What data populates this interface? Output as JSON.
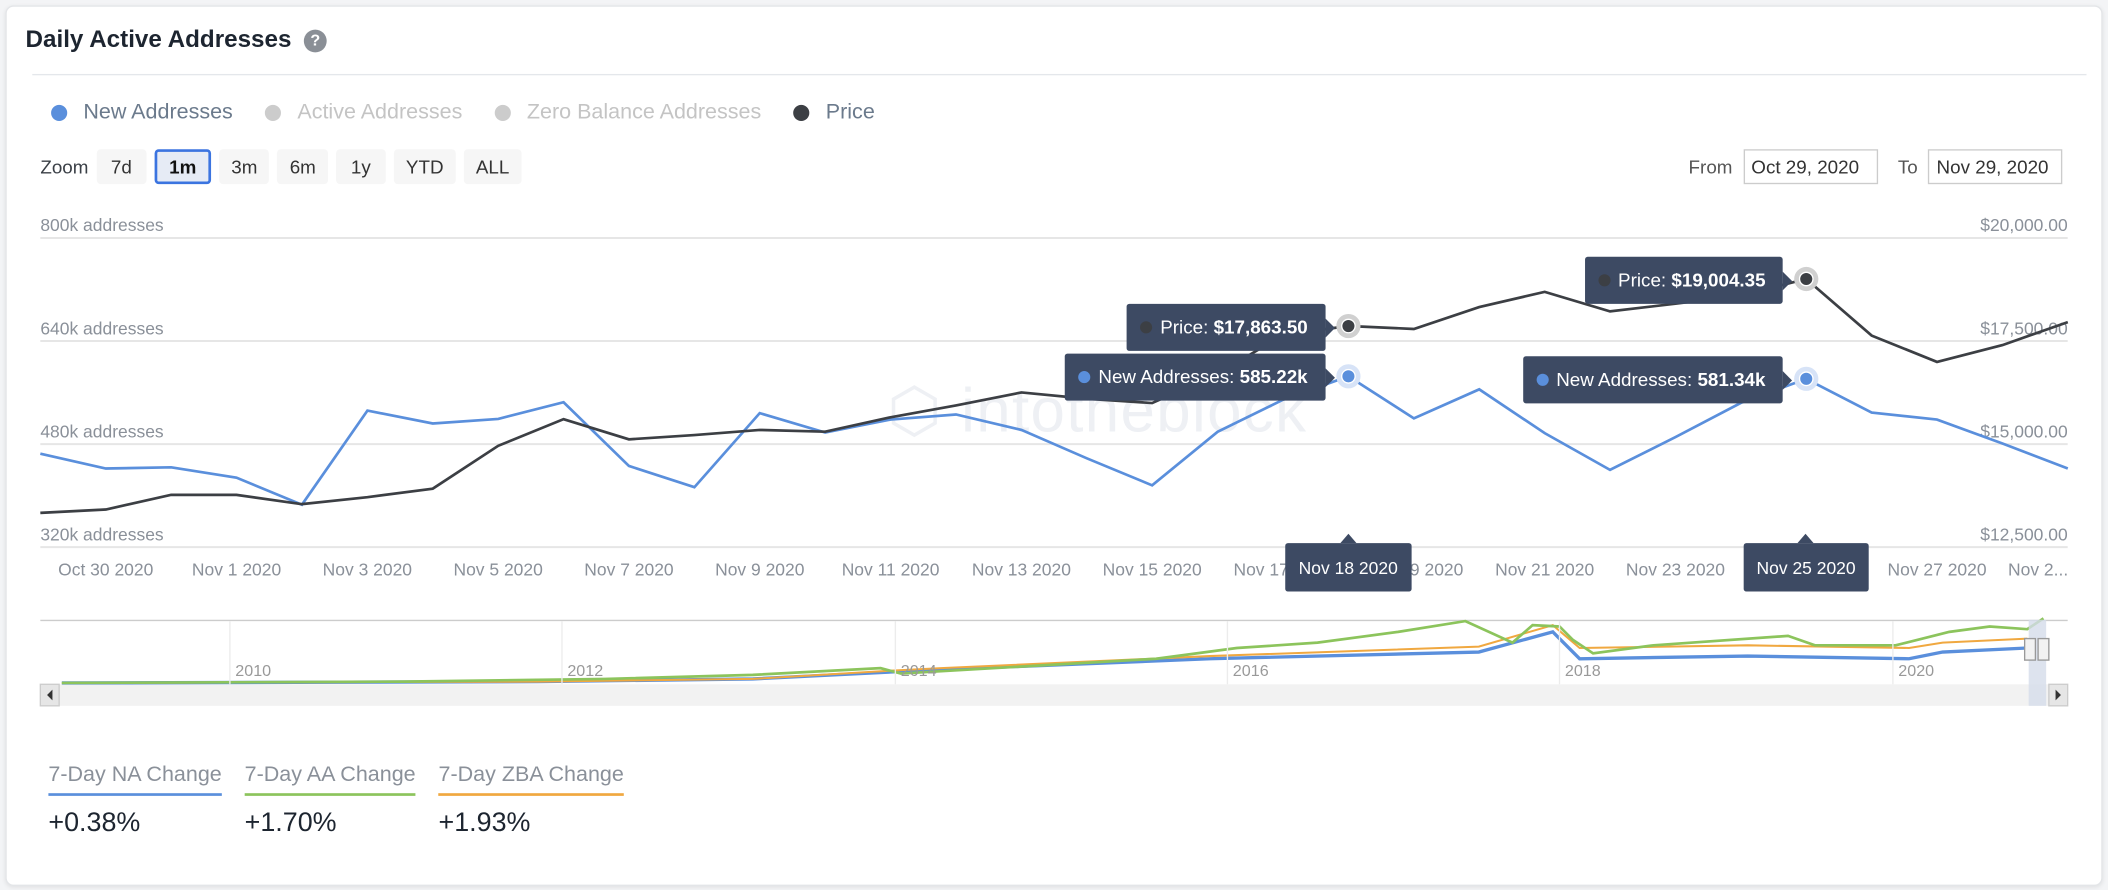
{
  "header": {
    "title": "Daily Active Addresses",
    "help_icon": "question-circle-icon"
  },
  "legend": [
    {
      "label": "New Addresses",
      "color": "#5a8fdc",
      "text_color": "#6b7a8c"
    },
    {
      "label": "Active Addresses",
      "color": "#cccccc",
      "text_color": "#c4c4c4"
    },
    {
      "label": "Zero Balance Addresses",
      "color": "#cccccc",
      "text_color": "#c4c4c4"
    },
    {
      "label": "Price",
      "color": "#3c3f44",
      "text_color": "#6b7a8c"
    }
  ],
  "zoom": {
    "label": "Zoom",
    "buttons": [
      "7d",
      "1m",
      "3m",
      "6m",
      "1y",
      "YTD",
      "ALL"
    ],
    "selected": "1m"
  },
  "range": {
    "from_label": "From",
    "from_value": "Oct 29, 2020",
    "to_label": "To",
    "to_value": "Nov 29, 2020"
  },
  "watermark": "intotheblock",
  "chart_data": {
    "type": "line",
    "x": [
      "Oct 29 2020",
      "Oct 30 2020",
      "Oct 31 2020",
      "Nov 1 2020",
      "Nov 2 2020",
      "Nov 3 2020",
      "Nov 4 2020",
      "Nov 5 2020",
      "Nov 6 2020",
      "Nov 7 2020",
      "Nov 8 2020",
      "Nov 9 2020",
      "Nov 10 2020",
      "Nov 11 2020",
      "Nov 12 2020",
      "Nov 13 2020",
      "Nov 14 2020",
      "Nov 15 2020",
      "Nov 16 2020",
      "Nov 17 2020",
      "Nov 18 2020",
      "Nov 19 2020",
      "Nov 20 2020",
      "Nov 21 2020",
      "Nov 22 2020",
      "Nov 23 2020",
      "Nov 24 2020",
      "Nov 25 2020",
      "Nov 26 2020",
      "Nov 27 2020",
      "Nov 28 2020",
      "Nov 29 2020"
    ],
    "x_tick_labels": [
      "Oct 30 2020",
      "Nov 1 2020",
      "Nov 3 2020",
      "Nov 5 2020",
      "Nov 7 2020",
      "Nov 9 2020",
      "Nov 11 2020",
      "Nov 13 2020",
      "Nov 15 2020",
      "Nov 17 2020",
      "Nov 19 2020",
      "Nov 21 2020",
      "Nov 23 2020",
      "Nov 25 2020",
      "Nov 27 2020",
      "Nov 2..."
    ],
    "series": [
      {
        "name": "New Addresses",
        "axis": "left",
        "unit": "k addresses",
        "color": "#5a8fdc",
        "values": [
          465,
          442,
          444,
          428,
          386,
          532,
          512,
          519,
          545,
          446,
          413,
          528,
          498,
          518,
          526,
          502,
          458,
          416,
          499,
          549,
          585.22,
          520,
          565,
          497,
          440,
          491,
          544,
          581.34,
          529,
          518,
          481,
          442
        ]
      },
      {
        "name": "Price",
        "axis": "right",
        "unit": "USD",
        "color": "#3c3f44",
        "values": [
          13331,
          13413,
          13770,
          13770,
          13542,
          13713,
          13917,
          14959,
          15603,
          15114,
          15220,
          15342,
          15301,
          15651,
          15936,
          16254,
          16100,
          15997,
          16700,
          17650,
          17863.5,
          17794,
          18325,
          18693,
          18219,
          18407,
          18600,
          19004.35,
          17631,
          16993,
          17402,
          17958
        ]
      }
    ],
    "y_left": {
      "ticks": [
        "320k addresses",
        "480k addresses",
        "640k addresses",
        "800k addresses"
      ],
      "range": [
        320,
        800
      ]
    },
    "y_right": {
      "ticks": [
        "$12,500.00",
        "$15,000.00",
        "$17,500.00",
        "$20,000.00"
      ],
      "range": [
        12500,
        20000
      ]
    },
    "grid": true,
    "tooltips": [
      {
        "date": "Nov 18 2020",
        "price_label": "Price: ",
        "price": "$17,863.50",
        "na_label": "New Addresses: ",
        "na": "585.22k"
      },
      {
        "date": "Nov 25 2020",
        "price_label": "Price: ",
        "price": "$19,004.35",
        "na_label": "New Addresses: ",
        "na": "581.34k"
      }
    ]
  },
  "navigator": {
    "years": [
      "2010",
      "2012",
      "2014",
      "2016",
      "2018",
      "2020"
    ],
    "colors": {
      "na": "#5a8fdc",
      "aa": "#8cc45c",
      "zba": "#f0a840"
    }
  },
  "stats": [
    {
      "label": "7-Day NA Change",
      "value": "+0.38%",
      "color": "#5a8fdc"
    },
    {
      "label": "7-Day AA Change",
      "value": "+1.70%",
      "color": "#8cc45c"
    },
    {
      "label": "7-Day ZBA Change",
      "value": "+1.93%",
      "color": "#f0a840"
    }
  ]
}
